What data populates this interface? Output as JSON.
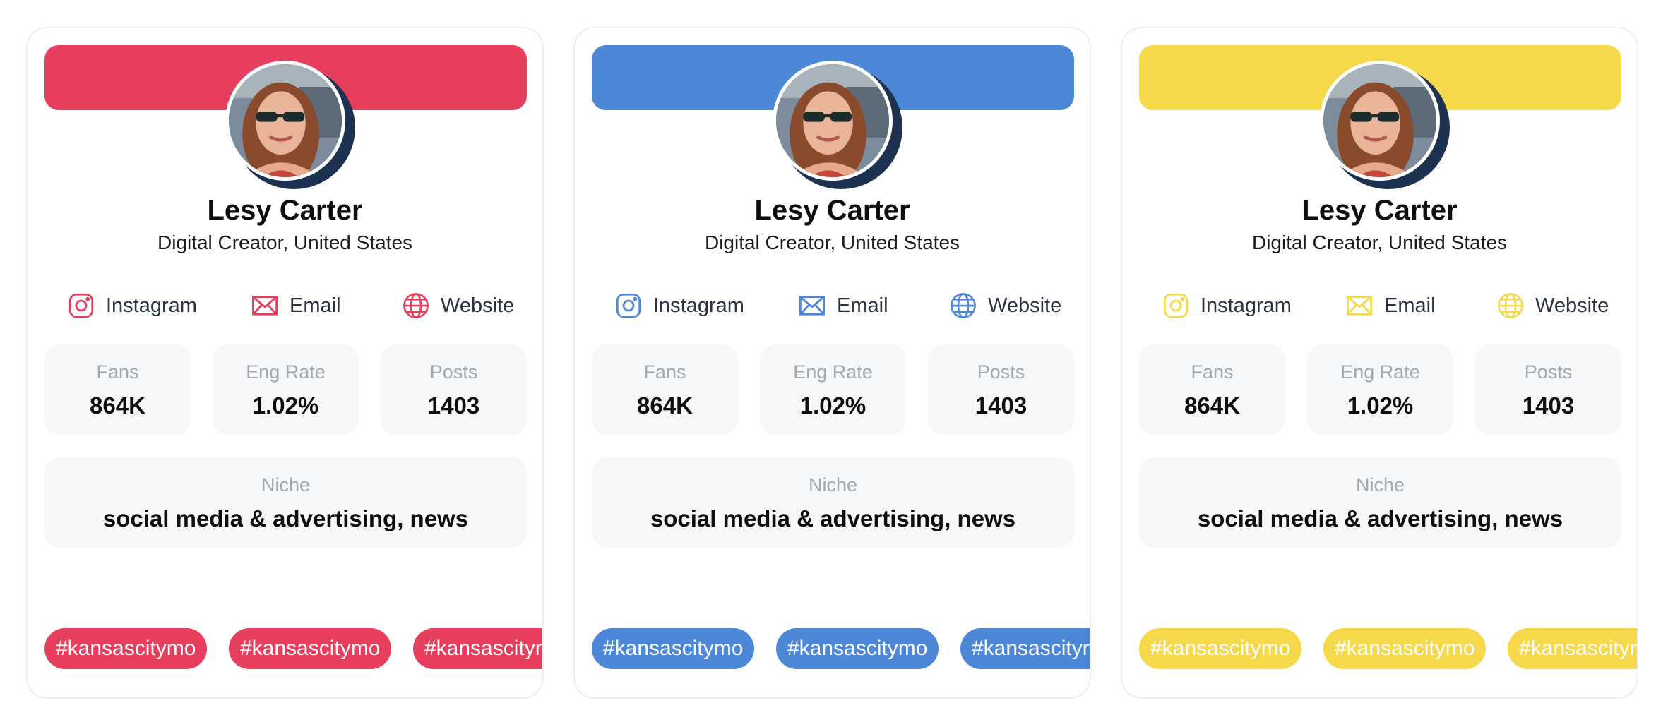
{
  "cards": [
    {
      "theme": "red",
      "accent": "#e83e5e",
      "name": "Lesy Carter",
      "subtitle": "Digital Creator, United States",
      "links": [
        {
          "label": "Instagram",
          "icon": "instagram-icon"
        },
        {
          "label": "Email",
          "icon": "email-icon"
        },
        {
          "label": "Website",
          "icon": "globe-icon"
        }
      ],
      "stats": [
        {
          "label": "Fans",
          "value": "864K"
        },
        {
          "label": "Eng Rate",
          "value": "1.02%"
        },
        {
          "label": "Posts",
          "value": "1403"
        }
      ],
      "niche": {
        "label": "Niche",
        "value": "social media & advertising, news"
      },
      "tags": [
        "#kansascitymo",
        "#kansascitymo",
        "#kansascitymo"
      ]
    },
    {
      "theme": "blue",
      "accent": "#4c87d8",
      "name": "Lesy Carter",
      "subtitle": "Digital Creator, United States",
      "links": [
        {
          "label": "Instagram",
          "icon": "instagram-icon"
        },
        {
          "label": "Email",
          "icon": "email-icon"
        },
        {
          "label": "Website",
          "icon": "globe-icon"
        }
      ],
      "stats": [
        {
          "label": "Fans",
          "value": "864K"
        },
        {
          "label": "Eng Rate",
          "value": "1.02%"
        },
        {
          "label": "Posts",
          "value": "1403"
        }
      ],
      "niche": {
        "label": "Niche",
        "value": "social media & advertising, news"
      },
      "tags": [
        "#kansascitymo",
        "#kansascitymo",
        "#kansascitymo"
      ]
    },
    {
      "theme": "yellow",
      "accent": "#f6d94b",
      "name": "Lesy Carter",
      "subtitle": "Digital Creator, United States",
      "links": [
        {
          "label": "Instagram",
          "icon": "instagram-icon"
        },
        {
          "label": "Email",
          "icon": "email-icon"
        },
        {
          "label": "Website",
          "icon": "globe-icon"
        }
      ],
      "stats": [
        {
          "label": "Fans",
          "value": "864K"
        },
        {
          "label": "Eng Rate",
          "value": "1.02%"
        },
        {
          "label": "Posts",
          "value": "1403"
        }
      ],
      "niche": {
        "label": "Niche",
        "value": "social media & advertising, news"
      },
      "tags": [
        "#kansascitymo",
        "#kansascitymo",
        "#kansascitymo"
      ]
    }
  ]
}
